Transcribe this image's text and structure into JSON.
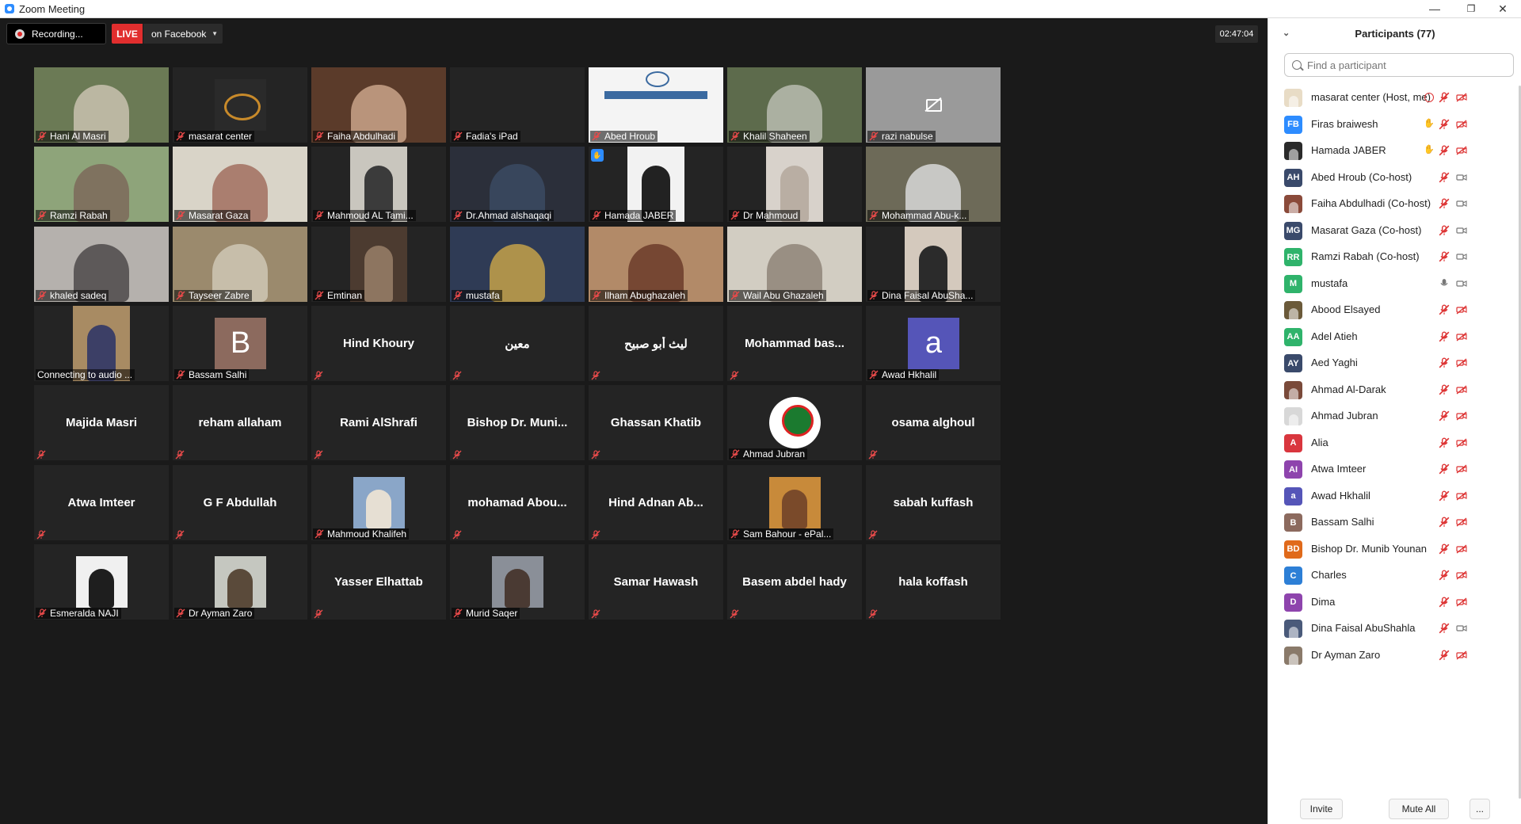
{
  "window": {
    "title": "Zoom Meeting",
    "minimize": "—",
    "restore": "❐",
    "close": "✕"
  },
  "toolbar": {
    "recording_label": "Recording...",
    "live_label": "LIVE",
    "live_destination": "on Facebook",
    "timer": "02:47:04"
  },
  "tiles": [
    {
      "name": "Hani Al Masri",
      "kind": "video",
      "bg": "#6b7a55",
      "fg": "#c9c2b0"
    },
    {
      "name": "masarat center",
      "kind": "logo",
      "bg": "#2a2a2a",
      "fg": "#f1ead8"
    },
    {
      "name": "Faiha Abdulhadi",
      "kind": "video",
      "bg": "#5b3b2a",
      "fg": "#caa58a"
    },
    {
      "name": "Fadia's iPad",
      "kind": "blank"
    },
    {
      "name": "Abed Hroub",
      "kind": "slide",
      "bg": "#f4f4f4",
      "fg": "#3b6aa0"
    },
    {
      "name": "Khalil Shaheen",
      "kind": "video",
      "bg": "#5d6b4c",
      "fg": "#b8bcb0"
    },
    {
      "name": "razi nabulse",
      "kind": "cam-off",
      "bg": "#9a9a9a"
    },
    {
      "name": "Ramzi Rabah",
      "kind": "video",
      "bg": "#8ea47a",
      "fg": "#7d6a5a"
    },
    {
      "name": "Masarat Gaza",
      "kind": "video",
      "bg": "#d9d4c8",
      "fg": "#a16f5f"
    },
    {
      "name": "Mahmoud AL Tami...",
      "kind": "video-small",
      "bg": "#c9c6be",
      "fg": "#3b3b3b"
    },
    {
      "name": "Dr.Ahmad alshaqaqi",
      "kind": "video",
      "bg": "#2b2f3a",
      "fg": "#3b4a63"
    },
    {
      "name": "Hamada JABER",
      "kind": "video-small",
      "bg": "#f2f2f2",
      "fg": "#222222",
      "hand": true
    },
    {
      "name": "Dr Mahmoud",
      "kind": "video-small",
      "bg": "#d8d2cb",
      "fg": "#b9aea3"
    },
    {
      "name": "Mohammad Abu-k...",
      "kind": "video",
      "bg": "#6d6a58",
      "fg": "#d8d8d8"
    },
    {
      "name": "khaled sadeq",
      "kind": "video",
      "bg": "#b5b1ad",
      "fg": "#4d4a4a"
    },
    {
      "name": "Tayseer Zabre",
      "kind": "video",
      "bg": "#9b8a6d",
      "fg": "#cfc7b5"
    },
    {
      "name": "Emtinan",
      "kind": "video-small",
      "bg": "#4c3b30",
      "fg": "#8d7560"
    },
    {
      "name": "mustafa",
      "kind": "video",
      "bg": "#2f3b55",
      "fg": "#c4a24a",
      "active": true
    },
    {
      "name": "Ilham Abughazaleh",
      "kind": "video",
      "bg": "#b28a68",
      "fg": "#6b3b2a"
    },
    {
      "name": "Wail Abu Ghazaleh",
      "kind": "video",
      "bg": "#d2cdc2",
      "fg": "#8f8478"
    },
    {
      "name": "Dina Faisal AbuSha...",
      "kind": "video-small",
      "bg": "#d4c9bd",
      "fg": "#2b2b2b"
    },
    {
      "name": "Connecting to audio ...",
      "kind": "video-small",
      "bg": "#a88b63",
      "fg": "#3c3f66",
      "connecting": true
    },
    {
      "name": "Bassam Salhi",
      "kind": "letter",
      "letter": "B",
      "bg": "#8c6a5e"
    },
    {
      "name": "Hind Khoury",
      "kind": "text"
    },
    {
      "name": "معين",
      "kind": "text"
    },
    {
      "name": "ليث أبو صبيح",
      "kind": "text"
    },
    {
      "name": "Mohammad  bas...",
      "kind": "text"
    },
    {
      "name": "Awad Hkhalil",
      "kind": "letter",
      "letter": "a",
      "bg": "#5555b8"
    },
    {
      "name": "Majida Masri",
      "kind": "text"
    },
    {
      "name": "reham allaham",
      "kind": "text"
    },
    {
      "name": "Rami AlShrafi",
      "kind": "text"
    },
    {
      "name": "Bishop  Dr.  Muni...",
      "kind": "text"
    },
    {
      "name": "Ghassan Khatib",
      "kind": "text"
    },
    {
      "name": "Ahmad Jubran",
      "kind": "logo2",
      "bg": "#ffffff",
      "fg": "#1b7a2f"
    },
    {
      "name": "osama alghoul",
      "kind": "text"
    },
    {
      "name": "Atwa Imteer",
      "kind": "text"
    },
    {
      "name": "G F Abdullah",
      "kind": "text"
    },
    {
      "name": "Mahmoud Khalifeh",
      "kind": "photo",
      "bg": "#8aa6c8",
      "fg": "#e6dfd3"
    },
    {
      "name": "mohamad  Abou...",
      "kind": "text"
    },
    {
      "name": "Hind Adnan  Ab...",
      "kind": "text"
    },
    {
      "name": "Sam Bahour - ePal...",
      "kind": "photo",
      "bg": "#c88a3a",
      "fg": "#7a4a2a"
    },
    {
      "name": "sabah kuffash",
      "kind": "text"
    },
    {
      "name": "Esmeralda NAJI",
      "kind": "photo",
      "bg": "#f0f0f0",
      "fg": "#1e1e1e"
    },
    {
      "name": "Dr Ayman Zaro",
      "kind": "photo",
      "bg": "#c5c7c0",
      "fg": "#5a4a3a"
    },
    {
      "name": "Yasser Elhattab",
      "kind": "text"
    },
    {
      "name": "Murid Saqer",
      "kind": "photo",
      "bg": "#8a8f98",
      "fg": "#4a3a33"
    },
    {
      "name": "Samar Hawash",
      "kind": "text"
    },
    {
      "name": "Basem abdel hady",
      "kind": "text"
    },
    {
      "name": "hala koffash",
      "kind": "text"
    }
  ],
  "panel": {
    "title": "Participants (77)",
    "collapse_icon": "⌄",
    "search_placeholder": "Find a participant",
    "participants": [
      {
        "name": "masarat center (Host, me)",
        "avatar": "img",
        "color": "#e8dcc6",
        "icon": "rec"
      },
      {
        "name": "Firas braiwesh",
        "avatar": "FB",
        "color": "#2d8cff",
        "icon": "hand"
      },
      {
        "name": "Hamada JABER",
        "avatar": "img",
        "color": "#2a2a2a",
        "icon": "hand"
      },
      {
        "name": "Abed Hroub (Co-host)",
        "avatar": "AH",
        "color": "#3a4a6b",
        "cam": "on"
      },
      {
        "name": "Faiha Abdulhadi (Co-host)",
        "avatar": "img",
        "color": "#8a4a3a",
        "cam": "on"
      },
      {
        "name": "Masarat Gaza (Co-host)",
        "avatar": "MG",
        "color": "#3a4a6b",
        "cam": "on"
      },
      {
        "name": "Ramzi Rabah (Co-host)",
        "avatar": "RR",
        "color": "#2fb36b",
        "cam": "on"
      },
      {
        "name": "mustafa",
        "avatar": "M",
        "color": "#2fb36b",
        "cam": "on",
        "mic": "on"
      },
      {
        "name": "Abood Elsayed",
        "avatar": "img",
        "color": "#6b5a3a"
      },
      {
        "name": "Adel Atieh",
        "avatar": "AA",
        "color": "#2fb36b"
      },
      {
        "name": "Aed Yaghi",
        "avatar": "AY",
        "color": "#3a4a6b"
      },
      {
        "name": "Ahmad Al-Darak",
        "avatar": "img",
        "color": "#7a4a3a"
      },
      {
        "name": "Ahmad Jubran",
        "avatar": "img",
        "color": "#d8d8d8"
      },
      {
        "name": "Alia",
        "avatar": "A",
        "color": "#d9363e"
      },
      {
        "name": "Atwa Imteer",
        "avatar": "AI",
        "color": "#8e44ad"
      },
      {
        "name": "Awad Hkhalil",
        "avatar": "a",
        "color": "#5555b8"
      },
      {
        "name": "Bassam Salhi",
        "avatar": "B",
        "color": "#8c6a5e"
      },
      {
        "name": "Bishop Dr. Munib Younan",
        "avatar": "BD",
        "color": "#e06a1b"
      },
      {
        "name": "Charles",
        "avatar": "C",
        "color": "#2d7fd6"
      },
      {
        "name": "Dima",
        "avatar": "D",
        "color": "#8e44ad"
      },
      {
        "name": "Dina Faisal AbuShahla",
        "avatar": "img",
        "color": "#4a5a7a",
        "cam": "on"
      },
      {
        "name": "Dr Ayman Zaro",
        "avatar": "img",
        "color": "#8a7a6a"
      }
    ],
    "invite_label": "Invite",
    "mute_all_label": "Mute All",
    "more_label": "..."
  }
}
